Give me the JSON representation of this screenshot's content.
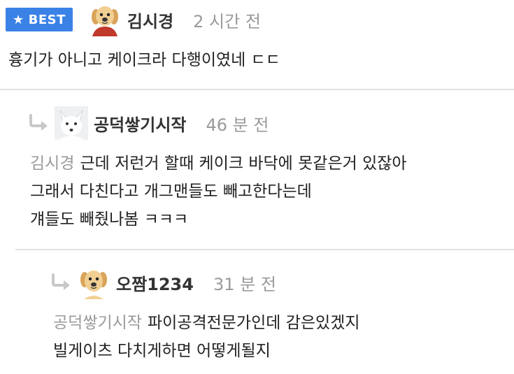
{
  "comments": [
    {
      "badge": "BEST",
      "username": "김시경",
      "time": "2 시간 전",
      "lines": [
        "흉기가 아니고 케이크라 다행이였네 ㄷㄷ"
      ],
      "mention": ""
    },
    {
      "badge": "",
      "username": "공덕쌓기시작",
      "time": "46 분 전",
      "mention": "김시경",
      "lines": [
        "근데 저런거 할때 케이크 바닥에 못같은거 있잖아",
        "그래서 다친다고 개그맨들도 빼고한다는데",
        "걔들도 빼줬나봄 ㅋㅋㅋ"
      ]
    },
    {
      "badge": "",
      "username": "오짬1234",
      "time": "31 분 전",
      "mention": "공덕쌓기시작",
      "lines": [
        "파이공격전문가인데 감은있겠지",
        "빌게이츠 다치게하면 어떻게될지"
      ]
    }
  ],
  "icons": {
    "badge_star": "star-icon",
    "reply": "reply-arrow-icon",
    "avatar_dog": "puppy-avatar-icon",
    "avatar_fox": "arctic-fox-avatar-icon"
  },
  "colors": {
    "badge_bg": "#3b82e6",
    "mention": "#9a9a9a",
    "time": "#9a9a9a",
    "divider": "#e3e3e3"
  }
}
